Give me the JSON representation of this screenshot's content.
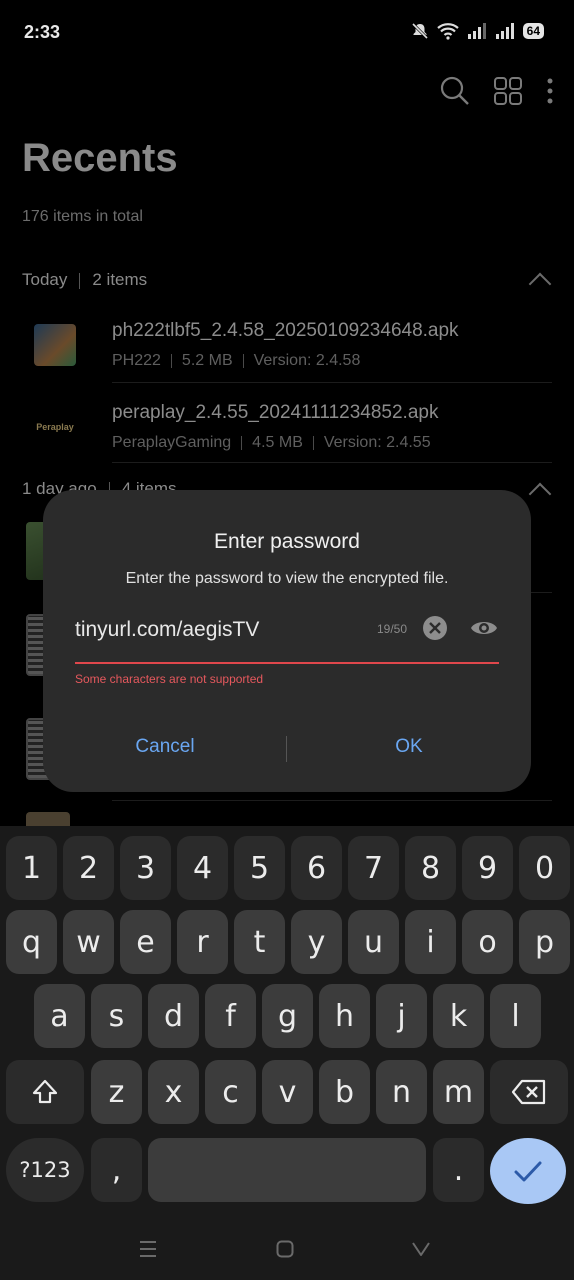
{
  "status_bar": {
    "time": "2:33",
    "battery": "64"
  },
  "header": {
    "title": "Recents",
    "subtitle": "176 items in total"
  },
  "sections": [
    {
      "label": "Today",
      "count": "2 items"
    },
    {
      "label": "1 day ago",
      "count": "4 items"
    }
  ],
  "files": [
    {
      "name": "ph222tlbf5_2.4.58_20250109234648.apk",
      "source": "PH222",
      "size": "5.2 MB",
      "version": "Version: 2.4.58"
    },
    {
      "name": "peraplay_2.4.55_20241111234852.apk",
      "source": "PeraplayGaming",
      "size": "4.5 MB",
      "version": "Version: 2.4.55",
      "logo_text": "Peraplay"
    }
  ],
  "dialog": {
    "title": "Enter password",
    "message": "Enter the password to view the encrypted file.",
    "password_value": "tinyurl.com/aegisTV",
    "char_count": "19/50",
    "error": "Some characters are not supported",
    "cancel_label": "Cancel",
    "ok_label": "OK"
  },
  "keyboard": {
    "numbers": [
      "1",
      "2",
      "3",
      "4",
      "5",
      "6",
      "7",
      "8",
      "9",
      "0"
    ],
    "row1": [
      "q",
      "w",
      "e",
      "r",
      "t",
      "y",
      "u",
      "i",
      "o",
      "p"
    ],
    "row2": [
      "a",
      "s",
      "d",
      "f",
      "g",
      "h",
      "j",
      "k",
      "l"
    ],
    "row3": [
      "z",
      "x",
      "c",
      "v",
      "b",
      "n",
      "m"
    ],
    "symbols_label": "?123",
    "comma": ",",
    "period": "."
  },
  "colors": {
    "accent": "#6aa7f2",
    "error": "#e0474c",
    "dialog_bg": "#2b2b2b",
    "enter_key": "#a9c8f5"
  }
}
